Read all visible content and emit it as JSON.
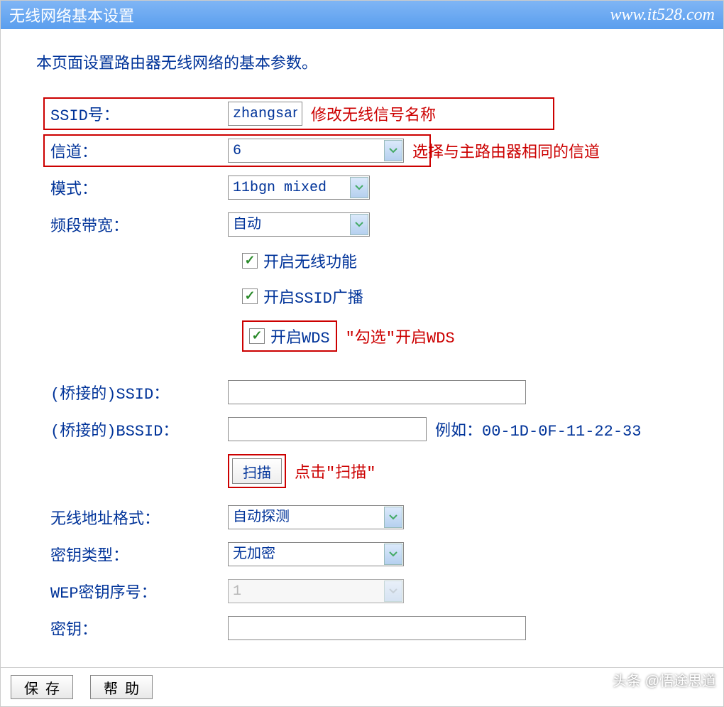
{
  "header": {
    "title": "无线网络基本设置",
    "url": "www.it528.com"
  },
  "description": "本页面设置路由器无线网络的基本参数。",
  "fields": {
    "ssid_label": "SSID号：",
    "ssid_value": "zhangsan",
    "ssid_annotation": "修改无线信号名称",
    "channel_label": "信道：",
    "channel_value": "6",
    "channel_annotation": "选择与主路由器相同的信道",
    "mode_label": "模式：",
    "mode_value": "11bgn mixed",
    "bandwidth_label": "频段带宽：",
    "bandwidth_value": "自动",
    "cb_wireless": "开启无线功能",
    "cb_ssid_broadcast": "开启SSID广播",
    "cb_wds": "开启WDS",
    "wds_annotation": "\"勾选\"开启WDS",
    "bridge_ssid_label": "(桥接的)SSID：",
    "bridge_ssid_value": "",
    "bridge_bssid_label": "(桥接的)BSSID：",
    "bridge_bssid_value": "",
    "bssid_example": "例如：00-1D-0F-11-22-33",
    "scan_button": "扫描",
    "scan_annotation": "点击\"扫描\"",
    "addr_format_label": "无线地址格式：",
    "addr_format_value": "自动探测",
    "key_type_label": "密钥类型：",
    "key_type_value": "无加密",
    "wep_index_label": "WEP密钥序号：",
    "wep_index_value": "1",
    "key_label": "密钥：",
    "key_value": ""
  },
  "footer": {
    "save": "保存",
    "help": "帮助"
  },
  "watermark": "头条 @悟途思道"
}
